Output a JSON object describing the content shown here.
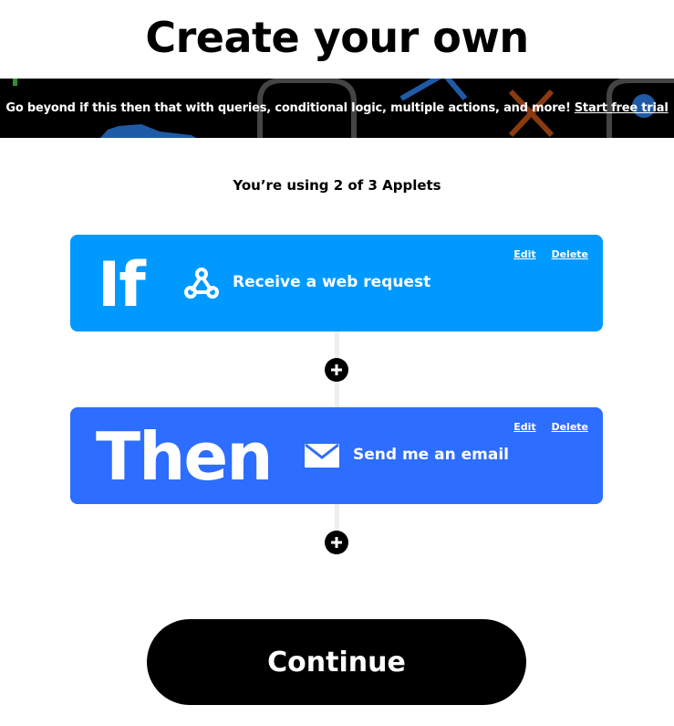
{
  "page": {
    "title": "Create your own"
  },
  "promo": {
    "text": "Go beyond if this then that with queries, conditional logic, multiple actions, and more!",
    "link_label": "Start free trial"
  },
  "usage": {
    "text": "You’re using 2 of 3 Applets"
  },
  "trigger": {
    "keyword": "If",
    "service_label": "Receive a web request",
    "icon": "webhook-icon",
    "edit_label": "Edit",
    "delete_label": "Delete",
    "color": "#0099ff"
  },
  "action": {
    "keyword": "Then",
    "service_label": "Send me an email",
    "icon": "email-icon",
    "edit_label": "Edit",
    "delete_label": "Delete",
    "color": "#2d6dff"
  },
  "continue_label": "Continue"
}
